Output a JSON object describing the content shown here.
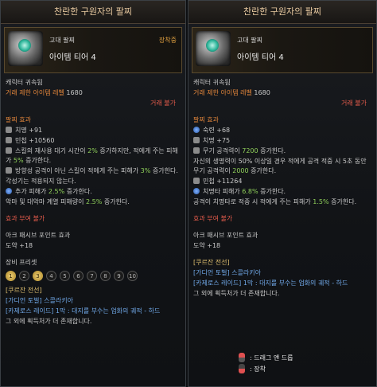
{
  "left": {
    "title": "찬란한 구원자의 팔찌",
    "grade": "고대 팔찌",
    "tier": "아이템 티어 4",
    "equipped": "장착중",
    "bound": "캐릭터 귀속됨",
    "level_label": "거래 제한 아이템 레벨",
    "level_value": "1680",
    "trade": "거래 불가",
    "effect_title": "팔찌 효과",
    "effects": {
      "e1": "치명 +91",
      "e2": "민첩 +10560",
      "e3a": "스킬의 재사용 대기 시간이 ",
      "e3b": "2%",
      "e3c": " 증가하지만, 적에게 주는 피해가 ",
      "e3d": "5%",
      "e3e": " 증가한다.",
      "e4a": "방향성 공격이 아닌 스킬이 적에게 주는 피해가 ",
      "e4b": "3%",
      "e4c": " 증가한다.",
      "e5": "각성기는 적용되지 않는다.",
      "e6a": "추가 피해가 ",
      "e6b": "2.5%",
      "e6c": " 증가한다.",
      "e7a": "악마 및 대악마 계열 피해량이 ",
      "e7b": "2.5%",
      "e7c": " 증가한다."
    },
    "grant": "효과 부여 불가",
    "ark": "아크 패시브 포인트 효과",
    "ark_val": "도약 +18",
    "set_title": "장비 프리셋",
    "slots": [
      "1",
      "2",
      "3",
      "4",
      "5",
      "6",
      "7",
      "8",
      "9",
      "10"
    ],
    "src_title": "[쿠르잔 전선]",
    "src1": "[가디언 토벌] 스콜라키아",
    "src2": "[카제로스 레이드] 1막 : 대지를 부수는 업화의 궤적 - 하드",
    "src3": "그 외에 획득처가 더 존재합니다."
  },
  "right": {
    "title": "찬란한 구원자의 팔찌",
    "grade": "고대 팔찌",
    "tier": "아이템 티어 4",
    "bound": "캐릭터 귀속됨",
    "level_label": "거래 제한 아이템 레벨",
    "level_value": "1680",
    "trade": "거래 불가",
    "effect_title": "팔찌 효과",
    "effects": {
      "e1": "숙련 +68",
      "e2": "치명 +75",
      "e3a": "무기 공격력이 ",
      "e3b": "7200",
      "e3c": " 증가한다.",
      "e4a": "자신의 생명력이 50% 이상일 경우 적에게 공격 적중 시 5초 동안 무기 공격력이 ",
      "e4b": "2000",
      "e4c": " 증가한다.",
      "e5": "민첩 +11264",
      "e6a": "치명타 피해가 ",
      "e6b": "6.8%",
      "e6c": " 증가한다.",
      "e7a": "공격이 치명타로 적중 시 적에게 주는 피해가 ",
      "e7b": "1.5%",
      "e7c": " 증가한다."
    },
    "grant": "효과 부여 불가",
    "ark": "아크 패시브 포인트 효과",
    "ark_val": "도약 +18",
    "src_title": "[쿠르잔 전선]",
    "src1": "[가디언 토벌] 스콜라키아",
    "src2": "[카제로스 레이드] 1막 : 대지를 부수는 업화의 궤적 - 하드",
    "src3": "그 외에 획득처가 더 존재합니다."
  },
  "hints": {
    "drag": ": 드래그 앤 드롭",
    "equip": ": 장착"
  }
}
